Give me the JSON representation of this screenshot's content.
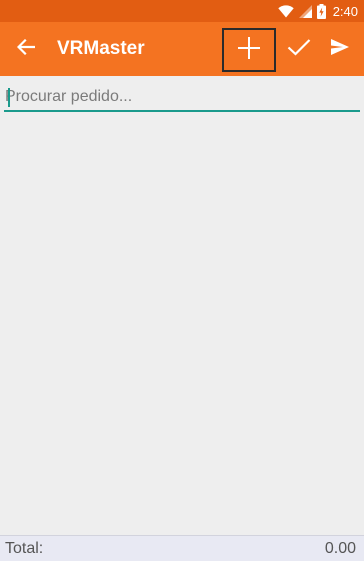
{
  "status_bar": {
    "time": "2:40",
    "icons": [
      "wifi-icon",
      "cell-signal-icon",
      "battery-charging-icon"
    ]
  },
  "toolbar": {
    "title": "VRMaster",
    "icons": {
      "back": "arrow-left-icon",
      "add": "plus-icon",
      "confirm": "check-icon",
      "send": "send-icon"
    }
  },
  "search": {
    "placeholder": "Procurar pedido...",
    "value": ""
  },
  "footer": {
    "total_label": "Total:",
    "total_value": "0.00"
  },
  "colors": {
    "status_bar": "#e25d12",
    "toolbar": "#f47321",
    "background": "#eeeeee",
    "input_underline": "#1a9a8c",
    "footer": "#e8e9f3"
  }
}
